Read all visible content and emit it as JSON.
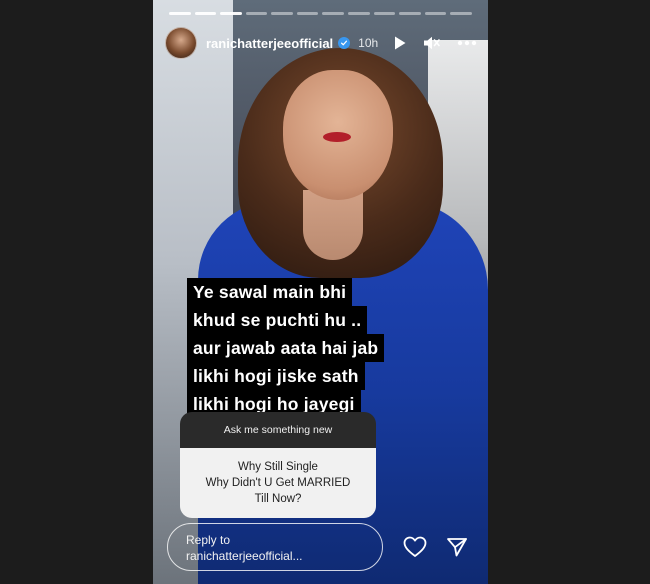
{
  "story": {
    "username": "ranichatterjeeofficial",
    "time_ago": "10h",
    "progress_segments": [
      1,
      1,
      1,
      0,
      0,
      0,
      0,
      0,
      0,
      0,
      0,
      0
    ]
  },
  "caption": {
    "lines": [
      "Ye sawal main bhi",
      "khud se puchti hu ..",
      "aur jawab aata hai jab",
      "likhi hogi jiske sath",
      "likhi hogi ho jayegi"
    ]
  },
  "question_sticker": {
    "prompt": "Ask me something new",
    "question_lines": [
      "Why Still Single",
      "Why Didn't U Get MARRIED",
      "Till Now?"
    ]
  },
  "reply": {
    "line1": "Reply to",
    "line2": "ranichatterjeeofficial..."
  },
  "icons": {
    "verified": "verified-badge-icon",
    "play": "play-icon",
    "mute": "mute-icon",
    "more": "more-options-icon",
    "like": "heart-icon",
    "send": "send-icon"
  },
  "colors": {
    "verified": "#3897f0",
    "sticker_top": "#2a2a2a",
    "sticker_bottom": "#f1f1f1",
    "suit_blue": "#1f44b8"
  }
}
